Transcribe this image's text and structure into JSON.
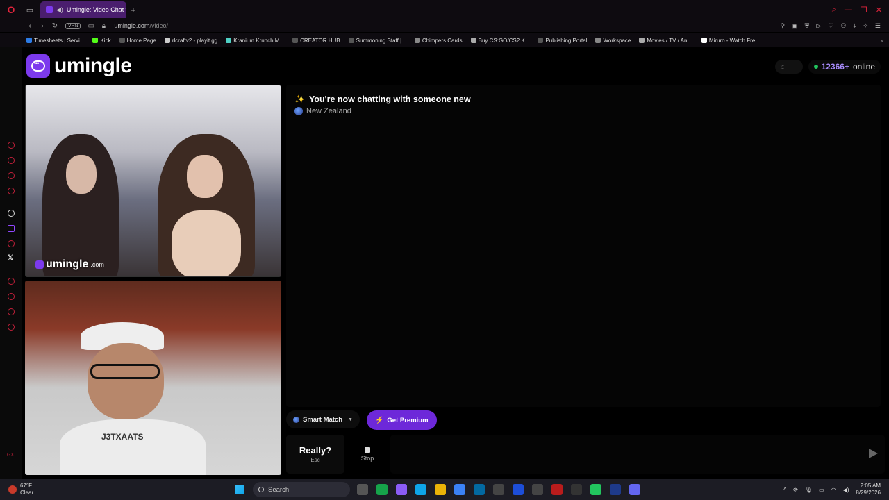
{
  "browser": {
    "tab_title": "Umingle: Video Chat wi",
    "url_host": "umingle.com",
    "url_path": "/video/",
    "vpn_label": "VPN",
    "bookmarks": [
      "Timesheets | Servi...",
      "Kick",
      "Home Page",
      "rlcraftv2 - playit.gg",
      "Kranium Krunch M...",
      "CREATOR HUB",
      "Summoning Staff |...",
      "Chimpers Cards",
      "Buy CS:GO/CS2 K...",
      "Publishing Portal",
      "Workspace",
      "Movies / TV / Ani...",
      "Miruro - Watch Fre..."
    ],
    "bookmark_colors": [
      "#2c7be5",
      "#53fc18",
      "#555",
      "#ccc",
      "#4fd1c5",
      "#555",
      "#555",
      "#888",
      "#aaa",
      "#555",
      "#888",
      "#aaa",
      "#fff"
    ]
  },
  "site": {
    "logo_text": "umingle",
    "online_count": "12366+",
    "online_label": "online",
    "watermark_text": "umingle",
    "watermark_suffix": ".com",
    "shirt_text": "J3TXAATS"
  },
  "chat": {
    "title": "You're now chatting with someone new",
    "country": "New Zealand"
  },
  "controls": {
    "smart_match_label": "Smart Match",
    "premium_label": "Get Premium",
    "really_label": "Really?",
    "really_key": "Esc",
    "stop_label": "Stop",
    "message_placeholder": ""
  },
  "taskbar": {
    "temperature": "67°F",
    "weather_condition": "Clear",
    "search_label": "Search",
    "time": "2:05 AM",
    "date": "8/29/2026"
  },
  "colors": {
    "accent": "#7c3aed",
    "online_dot": "#22c55e",
    "browser_red": "#e0243c"
  }
}
